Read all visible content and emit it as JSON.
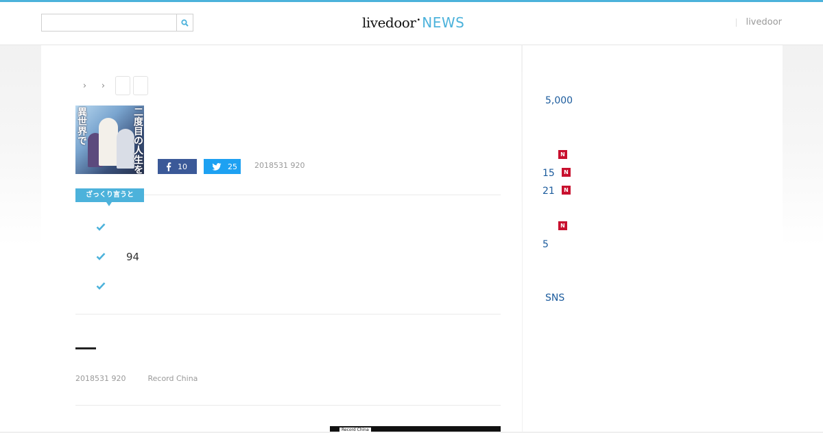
{
  "header": {
    "search": {
      "placeholder": "",
      "value": ""
    },
    "logo": {
      "brand": "livedoor",
      "product": "NEWS"
    },
    "right_link": "livedoor"
  },
  "breadcrumb": {
    "separator": "›"
  },
  "share": {
    "facebook_count": "10",
    "twitter_count": "25"
  },
  "article": {
    "date_top": "2018531 920",
    "summary_label": "ざっくり言うと",
    "points": [
      "",
      "94",
      ""
    ],
    "date": "2018531 920",
    "source": "Record China",
    "image_caption": "Record China"
  },
  "sidebar": {
    "items": [
      "5,000",
      "15",
      "21",
      "5",
      "SNS"
    ]
  },
  "colors": {
    "accent": "#4cb2db",
    "facebook": "#3b5998",
    "twitter": "#1da1f2",
    "new_badge": "#c8102e",
    "link": "#1a5a9c"
  },
  "icons": {
    "search": "search-icon",
    "check": "check-icon",
    "facebook": "facebook-icon",
    "twitter": "twitter-icon",
    "new": "new-badge"
  }
}
